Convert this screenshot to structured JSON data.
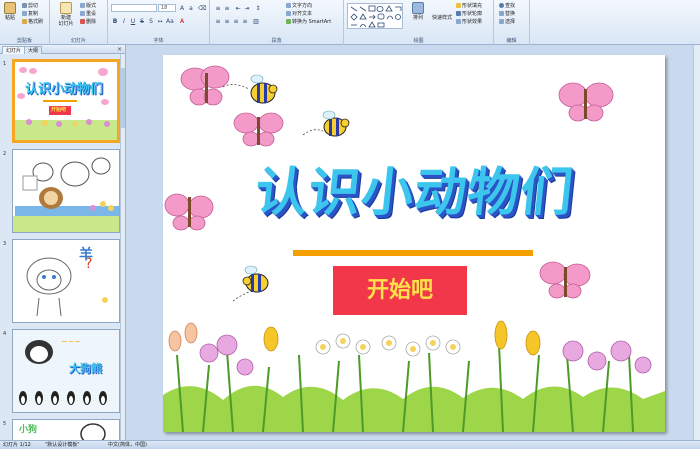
{
  "ribbon": {
    "clipboard": {
      "paste": "粘贴",
      "cut": "剪切",
      "copy": "复制",
      "format_painter": "格式刷",
      "group_label": "剪贴板"
    },
    "slides": {
      "new_slide": "新建\n幻灯片",
      "layout": "版式",
      "reset": "重设",
      "delete": "删除",
      "group_label": "幻灯片"
    },
    "font": {
      "font_name": "",
      "font_size": "18",
      "group_label": "字体"
    },
    "paragraph": {
      "text_direction": "文字方向",
      "align_text": "对齐文本",
      "smartart": "转换为 SmartArt",
      "group_label": "段落"
    },
    "drawing": {
      "arrange": "排列",
      "quick_styles": "快速样式",
      "shape_fill": "形状填充",
      "shape_outline": "形状轮廓",
      "shape_effects": "形状效果",
      "group_label": "绘图"
    },
    "editing": {
      "find": "查找",
      "replace": "替换",
      "select": "选择",
      "group_label": "编辑"
    }
  },
  "pane": {
    "tab_slides": "幻灯片",
    "tab_outline": "大纲",
    "close": "×",
    "thumbnails": [
      {
        "num": "1",
        "star": "",
        "title": "认识小动物们",
        "button": "开始吧"
      },
      {
        "num": "2",
        "star": "",
        "title": ""
      },
      {
        "num": "3",
        "star": "",
        "title": "羊"
      },
      {
        "num": "4",
        "star": "",
        "title": "大狗熊"
      },
      {
        "num": "5",
        "star": "",
        "title": "小狗"
      }
    ]
  },
  "slide": {
    "title": "认识小动物们",
    "start_button": "开始吧"
  },
  "status": {
    "slide_counter": "幻灯片 1/12",
    "theme": "\"默认设计模板\"",
    "language": "中文(简体，中国)"
  },
  "colors": {
    "title_fill": "#3cc6ee",
    "title_shadow": "#2a54c8",
    "underline": "#f5a000",
    "button_bg": "#f2374a",
    "button_text": "#ffe24a",
    "selection": "#f5a623"
  }
}
